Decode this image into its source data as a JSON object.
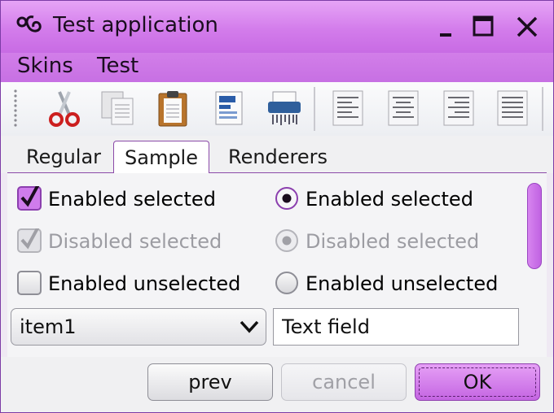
{
  "window": {
    "title": "Test application",
    "controls": {
      "minimize": "minimize-icon",
      "maximize": "maximize-icon",
      "close": "close-icon"
    }
  },
  "menubar": {
    "items": [
      "Skins",
      "Test"
    ]
  },
  "toolbar": {
    "buttons": [
      "cut-icon",
      "copy-icon",
      "paste-icon",
      "properties-icon",
      "shredder-icon",
      "align-left-icon",
      "align-center-icon",
      "align-right-icon",
      "align-justify-icon"
    ]
  },
  "tabs": {
    "items": [
      "Regular",
      "Sample",
      "Renderers"
    ],
    "selected": "Sample"
  },
  "form": {
    "checkboxes": [
      {
        "label": "Enabled selected",
        "checked": true,
        "enabled": true
      },
      {
        "label": "Disabled selected",
        "checked": true,
        "enabled": false
      },
      {
        "label": "Enabled unselected",
        "checked": false,
        "enabled": true
      }
    ],
    "radios": [
      {
        "label": "Enabled selected",
        "selected": true,
        "enabled": true
      },
      {
        "label": "Disabled selected",
        "selected": true,
        "enabled": false
      },
      {
        "label": "Enabled unselected",
        "selected": false,
        "enabled": true
      }
    ],
    "combo": {
      "value": "item1"
    },
    "textfield": {
      "value": "Text field"
    }
  },
  "buttons": {
    "prev": "prev",
    "cancel": "cancel",
    "ok": "OK"
  },
  "colors": {
    "accent": "#c86be4",
    "accent_dark": "#8b4aa8",
    "disabled_text": "#9c9ca2"
  }
}
